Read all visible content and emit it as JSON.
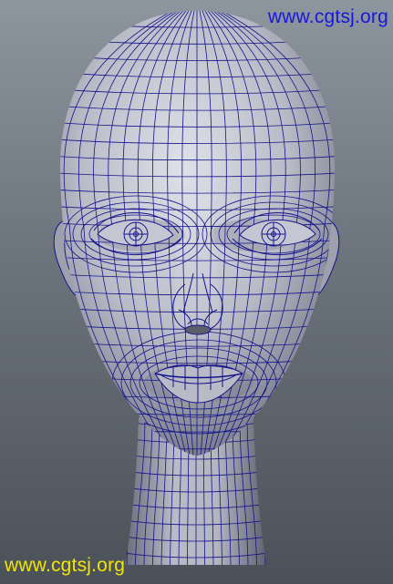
{
  "watermarks": {
    "top": "www.cgtsj.org",
    "bottom": "www.cgtsj.org"
  },
  "colors": {
    "background_top": "#8d959e",
    "background_bottom": "#4b5158",
    "skin_light": "#d9dbe3",
    "skin_mid": "#a5a8b4",
    "skin_dark": "#5e6170",
    "wireframe": "#14148a",
    "watermark_top": "#1717e0",
    "watermark_bottom": "#f2e600"
  },
  "scene": {
    "subject": "head-wireframe",
    "parts": [
      "skull",
      "face",
      "left-ear",
      "right-ear",
      "neck",
      "left-eye",
      "right-eye",
      "nose",
      "mouth"
    ]
  }
}
